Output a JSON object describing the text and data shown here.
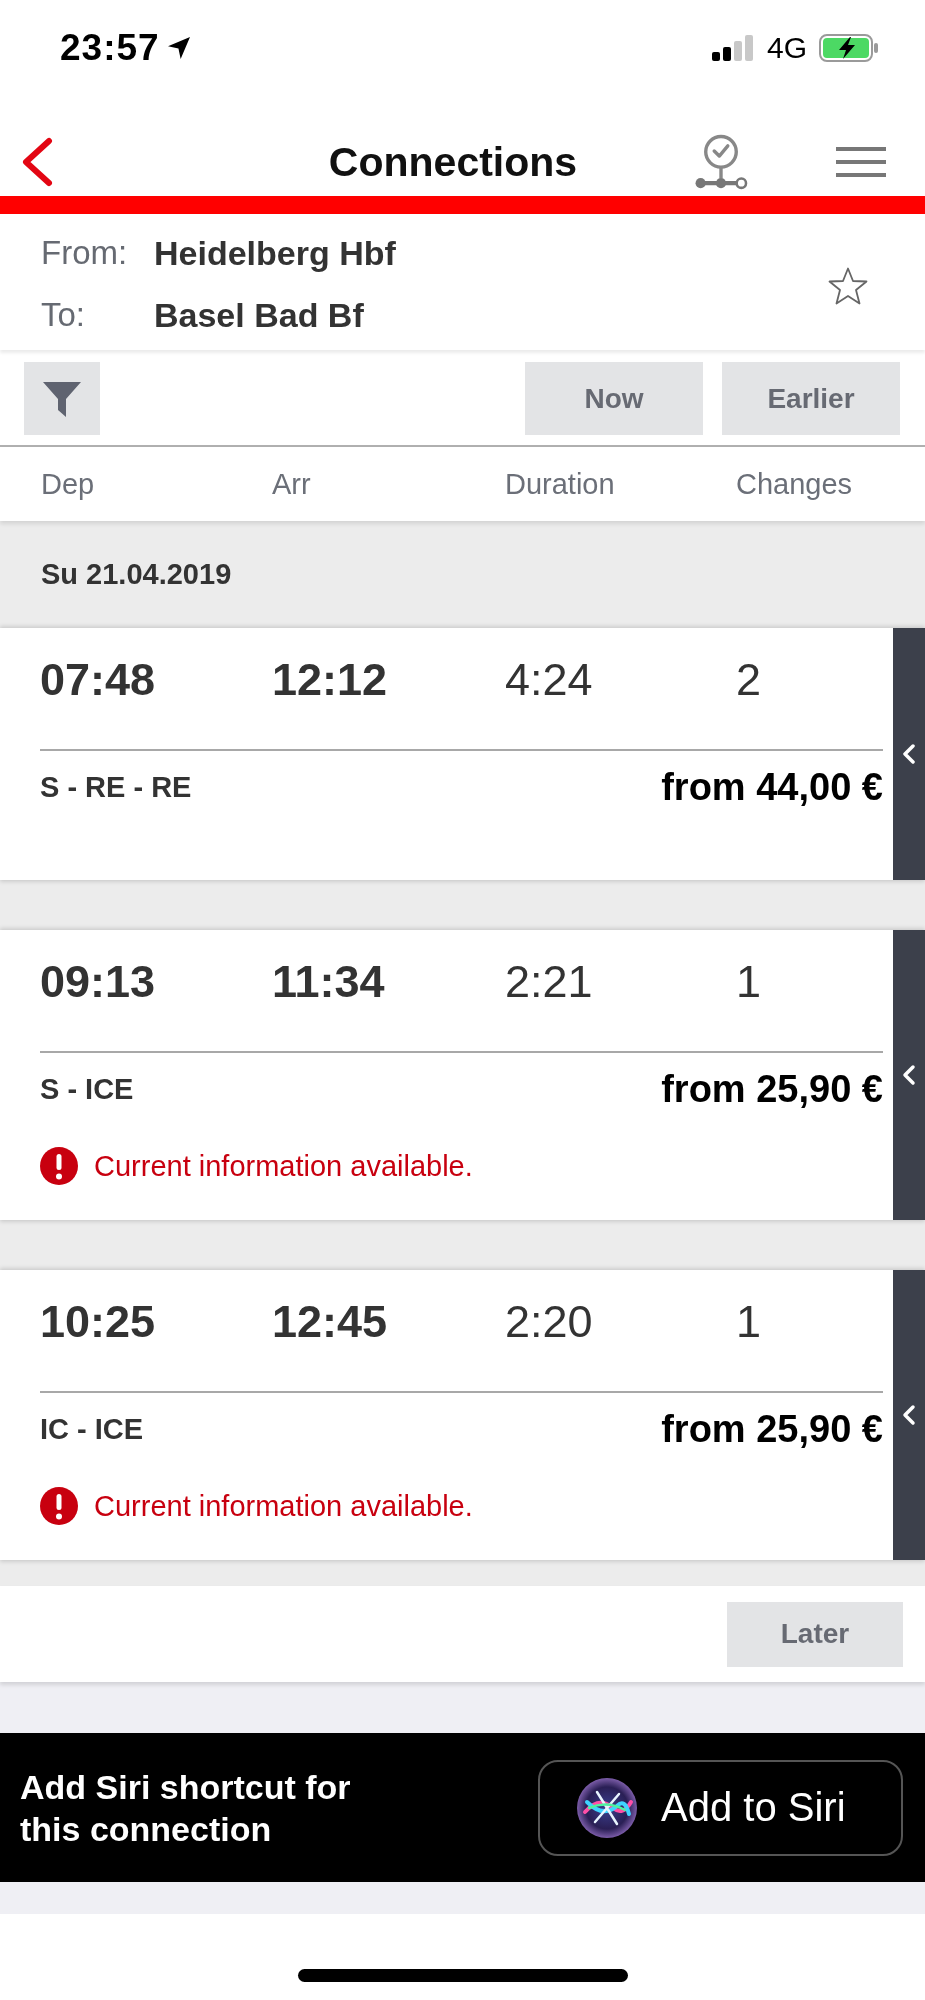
{
  "status_bar": {
    "time": "23:57",
    "network": "4G"
  },
  "header": {
    "title": "Connections"
  },
  "route": {
    "from_label": "From:",
    "from": "Heidelberg Hbf",
    "to_label": "To:",
    "to": "Basel Bad Bf",
    "starred": false
  },
  "toolbar": {
    "buttons": [
      "Now",
      "Earlier"
    ]
  },
  "columns": [
    "Dep",
    "Arr",
    "Duration",
    "Changes"
  ],
  "date": "Su 21.04.2019",
  "connections": [
    {
      "dep": "07:48",
      "arr": "12:12",
      "duration": "4:24",
      "changes": "2",
      "products": "S - RE - RE",
      "price": "from 44,00 €"
    },
    {
      "dep": "09:13",
      "arr": "11:34",
      "duration": "2:21",
      "changes": "1",
      "products": "S - ICE",
      "price": "from 25,90 €",
      "notice": "Current information available."
    },
    {
      "dep": "10:25",
      "arr": "12:45",
      "duration": "2:20",
      "changes": "1",
      "products": "IC - ICE",
      "price": "from 25,90 €",
      "notice": "Current information available."
    }
  ],
  "later_button": "Later",
  "siri": {
    "text": "Add Siri shortcut for this connection",
    "button": "Add to Siri"
  }
}
